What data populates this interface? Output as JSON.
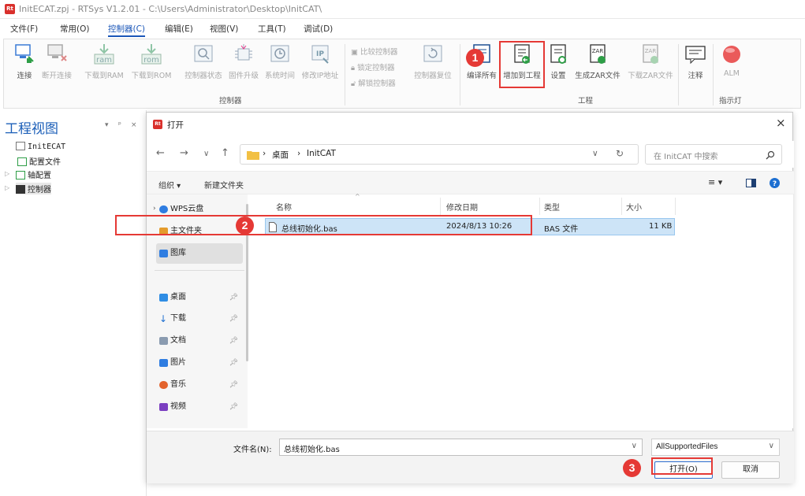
{
  "app": {
    "title": "InitECAT.zpj - RTSys V1.2.01 - C:\\Users\\Administrator\\Desktop\\InitCAT\\",
    "logo_text": "Rt"
  },
  "menu": [
    "文件(F)",
    "常用(O)",
    "控制器(C)",
    "编辑(E)",
    "视图(V)",
    "工具(T)",
    "调试(D)"
  ],
  "ribbon": {
    "controller_group": {
      "label": "控制器",
      "buttons": [
        "连接",
        "断开连接",
        "下载到RAM",
        "下载到ROM",
        "控制器状态",
        "固件升级",
        "系统时间",
        "修改IP地址"
      ],
      "small_buttons": [
        "比较控制器",
        "锁定控制器",
        "解锁控制器"
      ],
      "reset_button": "控制器复位",
      "ram_icon_text": "ram",
      "rom_icon_text": "rom"
    },
    "project_group": {
      "label": "工程",
      "buttons": [
        "编译所有",
        "增加到工程",
        "设置",
        "生成ZAR文件",
        "下载ZAR文件",
        "注释"
      ],
      "zar_icon_text": "ZAR"
    },
    "indicator_group": {
      "label": "指示灯",
      "alm_label": "ALM"
    }
  },
  "steps": [
    "1",
    "2",
    "3"
  ],
  "project_view": {
    "title": "工程视图",
    "controls": [
      "▾",
      "ᵖ",
      "×"
    ],
    "tree": [
      "InitECAT",
      "配置文件",
      "轴配置",
      "控制器"
    ]
  },
  "dialog": {
    "title": "打开",
    "logo_text": "Rt",
    "close": "×",
    "nav": {
      "back": "←",
      "forward": "→",
      "recent": "∨",
      "up": "↑",
      "crumbs": [
        "桌面",
        "InitCAT"
      ],
      "sep": "›",
      "dropdown": "∨",
      "refresh": "↻"
    },
    "search_placeholder": "在 InitCAT 中搜索",
    "toolbar": {
      "organize": "组织 ▾",
      "new_folder": "新建文件夹",
      "view_icon": "≡ ▾"
    },
    "nav_pane": [
      "WPS云盘",
      "主文件夹",
      "图库",
      "桌面",
      "下载",
      "文档",
      "图片",
      "音乐",
      "视频"
    ],
    "columns": [
      "名称",
      "修改日期",
      "类型",
      "大小"
    ],
    "files": [
      {
        "name": "总线初始化.bas",
        "date": "2024/8/13 10:26",
        "type": "BAS 文件",
        "size": "11 KB"
      }
    ],
    "filename_label": "文件名(N):",
    "filename_value": "总线初始化.bas",
    "filetype_value": "AllSupportedFiles",
    "open_button": "打开(O)",
    "cancel_button": "取消"
  },
  "colors": {
    "accent": "#1a56b8",
    "highlight": "#e53935",
    "selection": "#cde4f7"
  }
}
